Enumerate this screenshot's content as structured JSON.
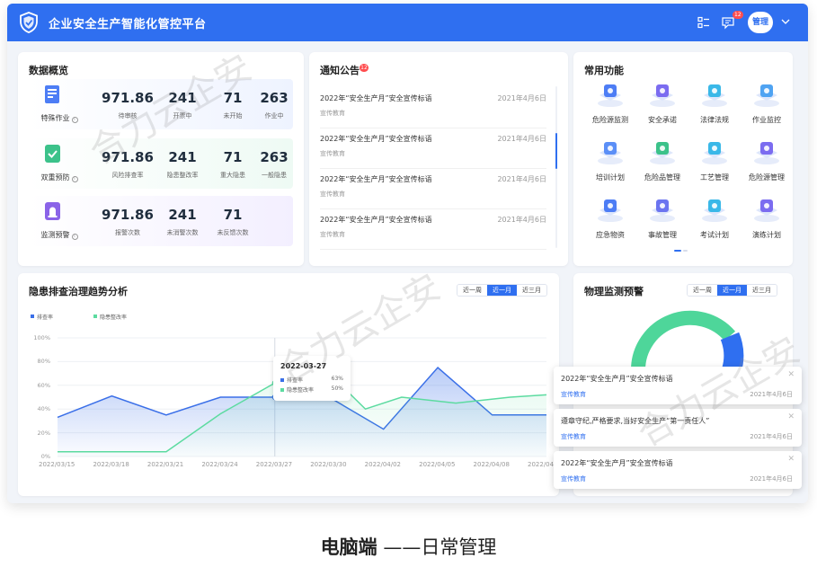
{
  "header": {
    "title": "企业安全生产智能化管控平台",
    "msg_count": "12",
    "user": "管理"
  },
  "overview": {
    "title": "数据概览",
    "rows": [
      {
        "label": "特殊作业",
        "stats": [
          {
            "value": "971.86",
            "label": "待审核"
          },
          {
            "value": "241",
            "label": "开票中"
          },
          {
            "value": "71",
            "label": "未开始"
          },
          {
            "value": "263",
            "label": "作业中"
          }
        ]
      },
      {
        "label": "双重预防",
        "stats": [
          {
            "value": "971.86",
            "label": "风险排查率"
          },
          {
            "value": "241",
            "label": "隐患整改率"
          },
          {
            "value": "71",
            "label": "重大隐患"
          },
          {
            "value": "263",
            "label": "一般隐患"
          }
        ]
      },
      {
        "label": "监测预警",
        "stats": [
          {
            "value": "971.86",
            "label": "报警次数"
          },
          {
            "value": "241",
            "label": "未消警次数"
          },
          {
            "value": "71",
            "label": "未反馈次数"
          }
        ]
      }
    ]
  },
  "notices": {
    "title": "通知公告",
    "badge": "12",
    "items": [
      {
        "text": "2022年“安全生产月”安全宣传标语",
        "date": "2021年4月6日",
        "tag": "宣传教育"
      },
      {
        "text": "2022年“安全生产月”安全宣传标语",
        "date": "2021年4月6日",
        "tag": "宣传教育"
      },
      {
        "text": "2022年“安全生产月”安全宣传标语",
        "date": "2021年4月6日",
        "tag": "宣传教育"
      },
      {
        "text": "2022年“安全生产月”安全宣传标语",
        "date": "2021年4月6日",
        "tag": "宣传教育"
      }
    ]
  },
  "functions": {
    "title": "常用功能",
    "items": [
      {
        "label": "危险源监测",
        "icon": "hazard-monitor-icon"
      },
      {
        "label": "安全承诺",
        "icon": "safety-pledge-icon"
      },
      {
        "label": "法律法规",
        "icon": "law-icon"
      },
      {
        "label": "作业监控",
        "icon": "work-monitor-icon"
      },
      {
        "label": "培训计划",
        "icon": "training-icon"
      },
      {
        "label": "危险品管理",
        "icon": "chemical-icon"
      },
      {
        "label": "工艺管理",
        "icon": "process-icon"
      },
      {
        "label": "危险源管理",
        "icon": "hazard-manage-icon"
      },
      {
        "label": "应急物资",
        "icon": "emergency-supply-icon"
      },
      {
        "label": "事故管理",
        "icon": "accident-icon"
      },
      {
        "label": "考试计划",
        "icon": "exam-icon"
      },
      {
        "label": "演练计划",
        "icon": "drill-icon"
      }
    ]
  },
  "trend": {
    "title": "隐患排查治理趋势分析",
    "ranges": [
      "近一周",
      "近一月",
      "近三月"
    ],
    "active_range": 1
  },
  "tooltip": {
    "date": "2022-03-27",
    "rows": [
      {
        "name": "排查率",
        "value": "63%"
      },
      {
        "name": "隐患整改率",
        "value": "50%"
      }
    ]
  },
  "chart_data": {
    "type": "line",
    "x": [
      "2022/03/15",
      "2022/03/16",
      "2022/03/17",
      "2022/03/18",
      "2022/03/19",
      "2022/03/20",
      "2022/03/21",
      "2022/03/22",
      "2022/03/23",
      "2022/03/24",
      "2022/03/25",
      "2022/03/26",
      "2022/03/27",
      "2022/03/28",
      "2022/03/29",
      "2022/03/30",
      "2022/03/31",
      "2022/04/01",
      "2022/04/02",
      "2022/04/03",
      "2022/04/04",
      "2022/04/05",
      "2022/04/06",
      "2022/04/07",
      "2022/04/08",
      "2022/04/09",
      "2022/04/10",
      "2022/04/11"
    ],
    "xticks": [
      "2022/03/15",
      "2022/03/18",
      "2022/03/21",
      "2022/03/24",
      "2022/03/27",
      "2022/03/30",
      "2022/04/02",
      "2022/04/05",
      "2022/04/08",
      "2022/04/11"
    ],
    "series": [
      {
        "name": "排查率",
        "color": "#3a6fe8",
        "values": [
          33,
          null,
          null,
          51,
          null,
          null,
          35,
          null,
          null,
          50,
          null,
          null,
          50,
          null,
          null,
          50,
          null,
          null,
          23,
          null,
          null,
          75,
          null,
          null,
          35,
          null,
          null,
          35
        ]
      },
      {
        "name": "隐患整改率",
        "color": "#5cdba0",
        "values": [
          4,
          null,
          null,
          4,
          null,
          null,
          4,
          null,
          null,
          36,
          null,
          null,
          62,
          null,
          null,
          68,
          55,
          40,
          null,
          50,
          null,
          null,
          45,
          null,
          null,
          50,
          null,
          52
        ]
      }
    ],
    "yticks": [
      "0%",
      "20%",
      "40%",
      "60%",
      "80%",
      "100%"
    ],
    "ylim": [
      0,
      100
    ],
    "legend": "top-left",
    "grid": true
  },
  "monitor": {
    "title": "物理监测预警",
    "ranges": [
      "近一周",
      "近一月",
      "近三月"
    ],
    "active_range": 1,
    "popups": [
      {
        "text": "2022年“安全生产月”安全宣传标语",
        "tag": "宣传教育",
        "date": "2021年4月6日"
      },
      {
        "text": "遵章守纪,严格要求,当好安全生产“第一责任人”",
        "tag": "宣传教育",
        "date": "2021年4月6日"
      },
      {
        "text": "2022年“安全生产月”安全宣传标语",
        "tag": "宣传教育",
        "date": "2021年4月6日"
      }
    ]
  },
  "watermark": "合力云企安",
  "caption": {
    "strong": "电脑端",
    "rest": " ——日常管理"
  }
}
